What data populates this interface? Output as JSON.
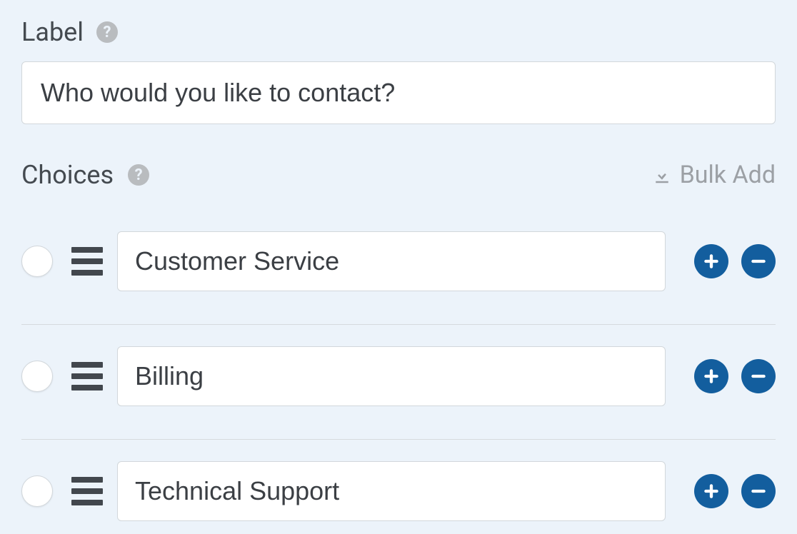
{
  "label_section": {
    "title": "Label",
    "value": "Who would you like to contact?"
  },
  "choices_section": {
    "title": "Choices",
    "bulk_add": "Bulk Add"
  },
  "choices": [
    {
      "value": "Customer Service"
    },
    {
      "value": "Billing"
    },
    {
      "value": "Technical Support"
    }
  ]
}
